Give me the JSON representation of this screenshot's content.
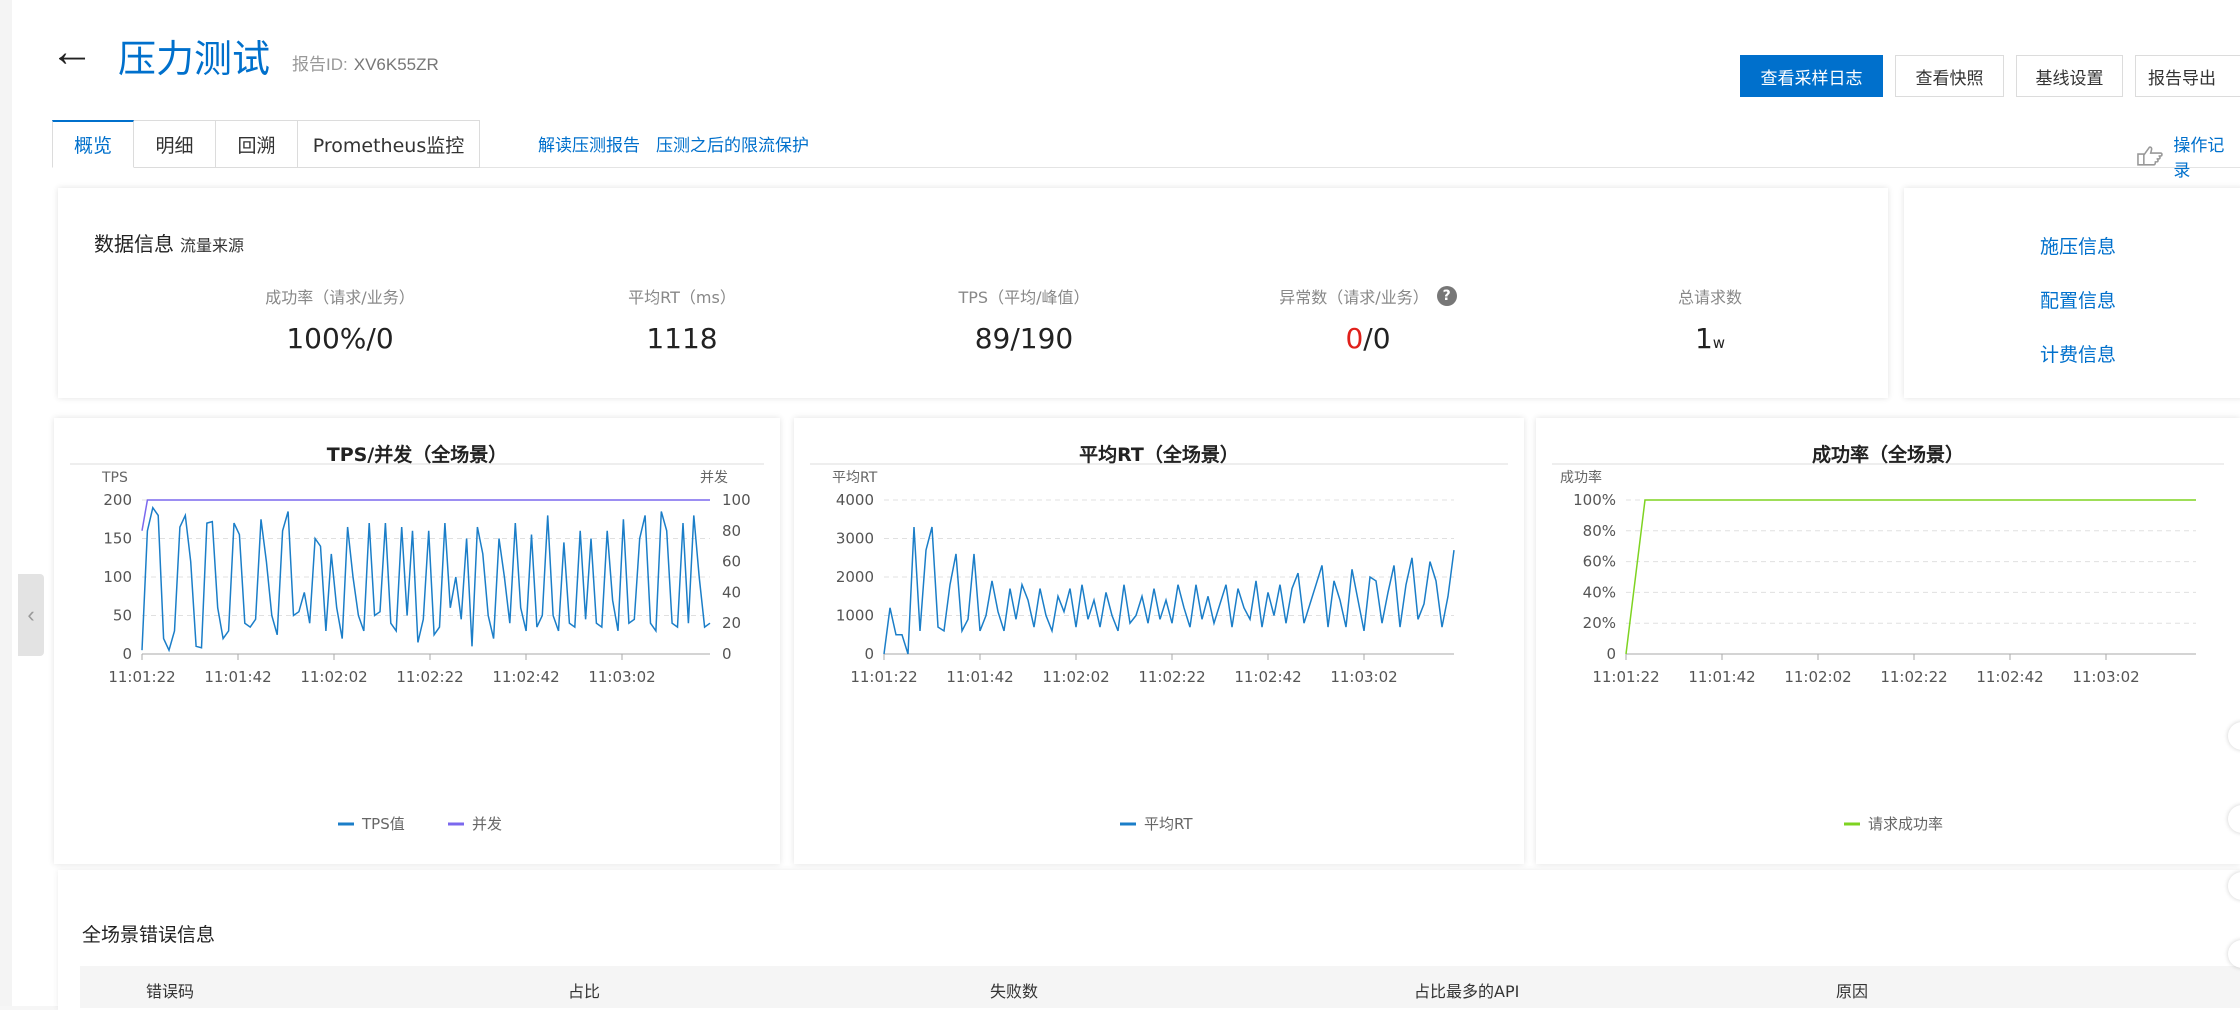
{
  "header": {
    "back_icon": "arrow-left-icon",
    "title": "压力测试",
    "report_id_label": "报告ID:",
    "report_id": "XV6K55ZR",
    "actions": [
      "查看采样日志",
      "查看快照",
      "基线设置",
      "报告导出"
    ]
  },
  "tabs": [
    "概览",
    "明细",
    "回溯",
    "Prometheus监控"
  ],
  "tab_links": [
    "解读压测报告",
    "压测之后的限流保护"
  ],
  "op_log": {
    "label": "操作记录",
    "icon": "pointing-hand-icon"
  },
  "data_info": {
    "title": "数据信息",
    "subtitle": "流量来源",
    "metrics": [
      {
        "label": "成功率（请求/业务）",
        "value": "100%/0"
      },
      {
        "label": "平均RT（ms）",
        "value": "1118"
      },
      {
        "label": "TPS（平均/峰值）",
        "value": "89/190"
      },
      {
        "label": "异常数（请求/业务）",
        "value_red": "0",
        "value_rest": "/0",
        "help": "?"
      },
      {
        "label": "总请求数",
        "value": "1",
        "unit": "w"
      }
    ]
  },
  "side_links": [
    "施压信息",
    "配置信息",
    "计费信息"
  ],
  "colors": {
    "accent": "#0070cc",
    "tps_line": "#1b7ec8",
    "concurrency_line": "#7b68ee",
    "success_line": "#7ed321",
    "error": "#e0201b"
  },
  "chart_data": [
    {
      "type": "line",
      "title": "TPS/并发（全场景）",
      "ylabel": "TPS",
      "y2label": "并发",
      "x_ticks": [
        "11:01:22",
        "11:01:42",
        "11:02:02",
        "11:02:22",
        "11:02:42",
        "11:03:02"
      ],
      "y_ticks": [
        0,
        50,
        100,
        150,
        200
      ],
      "y2_ticks": [
        0,
        20,
        40,
        60,
        80,
        100
      ],
      "ylim": [
        0,
        200
      ],
      "y2lim": [
        0,
        100
      ],
      "series": [
        {
          "name": "TPS值",
          "axis": "left",
          "values": [
            5,
            160,
            190,
            180,
            20,
            5,
            30,
            165,
            180,
            120,
            10,
            8,
            170,
            172,
            60,
            20,
            30,
            170,
            155,
            40,
            35,
            45,
            175,
            120,
            50,
            25,
            160,
            185,
            50,
            55,
            80,
            40,
            150,
            140,
            30,
            130,
            60,
            20,
            165,
            100,
            50,
            30,
            170,
            50,
            55,
            170,
            40,
            30,
            165,
            50,
            160,
            15,
            45,
            160,
            25,
            35,
            170,
            60,
            100,
            45,
            150,
            10,
            165,
            130,
            50,
            20,
            150,
            100,
            40,
            170,
            60,
            30,
            155,
            35,
            50,
            180,
            50,
            30,
            145,
            40,
            35,
            160,
            45,
            150,
            40,
            35,
            160,
            70,
            30,
            175,
            40,
            45,
            150,
            180,
            40,
            30,
            185,
            160,
            40,
            35,
            170,
            40,
            180,
            100,
            35,
            40
          ]
        },
        {
          "name": "并发",
          "axis": "right",
          "values": [
            80,
            100,
            100,
            100,
            100,
            100,
            100,
            100,
            100,
            100,
            100,
            100,
            100,
            100,
            100,
            100,
            100,
            100,
            100,
            100,
            100,
            100,
            100,
            100,
            100,
            100,
            100,
            100,
            100,
            100,
            100,
            100,
            100,
            100,
            100,
            100,
            100,
            100,
            100,
            100,
            100,
            100,
            100,
            100,
            100,
            100,
            100,
            100,
            100,
            100,
            100,
            100,
            100,
            100,
            100,
            100,
            100,
            100,
            100,
            100,
            100,
            100,
            100,
            100,
            100,
            100,
            100,
            100,
            100,
            100,
            100,
            100,
            100,
            100,
            100,
            100,
            100,
            100,
            100,
            100,
            100,
            100,
            100,
            100,
            100,
            100,
            100,
            100,
            100,
            100,
            100,
            100,
            100,
            100,
            100,
            100,
            100,
            100,
            100,
            100,
            100,
            100,
            100,
            100,
            100,
            100
          ]
        }
      ]
    },
    {
      "type": "line",
      "title": "平均RT（全场景）",
      "ylabel": "平均RT",
      "x_ticks": [
        "11:01:22",
        "11:01:42",
        "11:02:02",
        "11:02:22",
        "11:02:42",
        "11:03:02"
      ],
      "y_ticks": [
        0,
        1000,
        2000,
        3000,
        4000
      ],
      "ylim": [
        0,
        4000
      ],
      "series": [
        {
          "name": "平均RT",
          "values": [
            0,
            1200,
            500,
            500,
            0,
            3300,
            600,
            2700,
            3300,
            700,
            600,
            1800,
            2600,
            600,
            900,
            2600,
            600,
            1000,
            1900,
            1100,
            600,
            1700,
            900,
            1800,
            1400,
            700,
            1700,
            1000,
            600,
            1500,
            1100,
            1700,
            700,
            1800,
            900,
            1400,
            700,
            1600,
            1000,
            600,
            1800,
            800,
            1000,
            1500,
            800,
            1700,
            900,
            1400,
            800,
            1800,
            1200,
            700,
            1800,
            900,
            1500,
            800,
            1300,
            1800,
            700,
            1700,
            1200,
            900,
            1900,
            700,
            1600,
            1000,
            1800,
            800,
            1700,
            2100,
            800,
            1300,
            1800,
            2300,
            700,
            1900,
            1400,
            700,
            2200,
            1400,
            600,
            2000,
            1900,
            800,
            1600,
            2300,
            700,
            1800,
            2500,
            900,
            1300,
            2400,
            1900,
            700,
            1500,
            2700
          ]
        }
      ]
    },
    {
      "type": "line",
      "title": "成功率（全场景）",
      "ylabel": "成功率",
      "x_ticks": [
        "11:01:22",
        "11:01:42",
        "11:02:02",
        "11:02:22",
        "11:02:42",
        "11:03:02"
      ],
      "y_ticks": [
        "0",
        "20%",
        "40%",
        "60%",
        "80%",
        "100%"
      ],
      "ylim": [
        0,
        100
      ],
      "series": [
        {
          "name": "请求成功率",
          "values": [
            0,
            100,
            100,
            100,
            100,
            100,
            100,
            100,
            100,
            100,
            100,
            100,
            100,
            100,
            100,
            100,
            100,
            100,
            100,
            100,
            100,
            100,
            100,
            100,
            100,
            100,
            100,
            100,
            100,
            100,
            100
          ]
        }
      ]
    }
  ],
  "errors": {
    "title": "全场景错误信息",
    "columns": [
      "错误码",
      "占比",
      "失败数",
      "占比最多的API",
      "原因"
    ]
  }
}
